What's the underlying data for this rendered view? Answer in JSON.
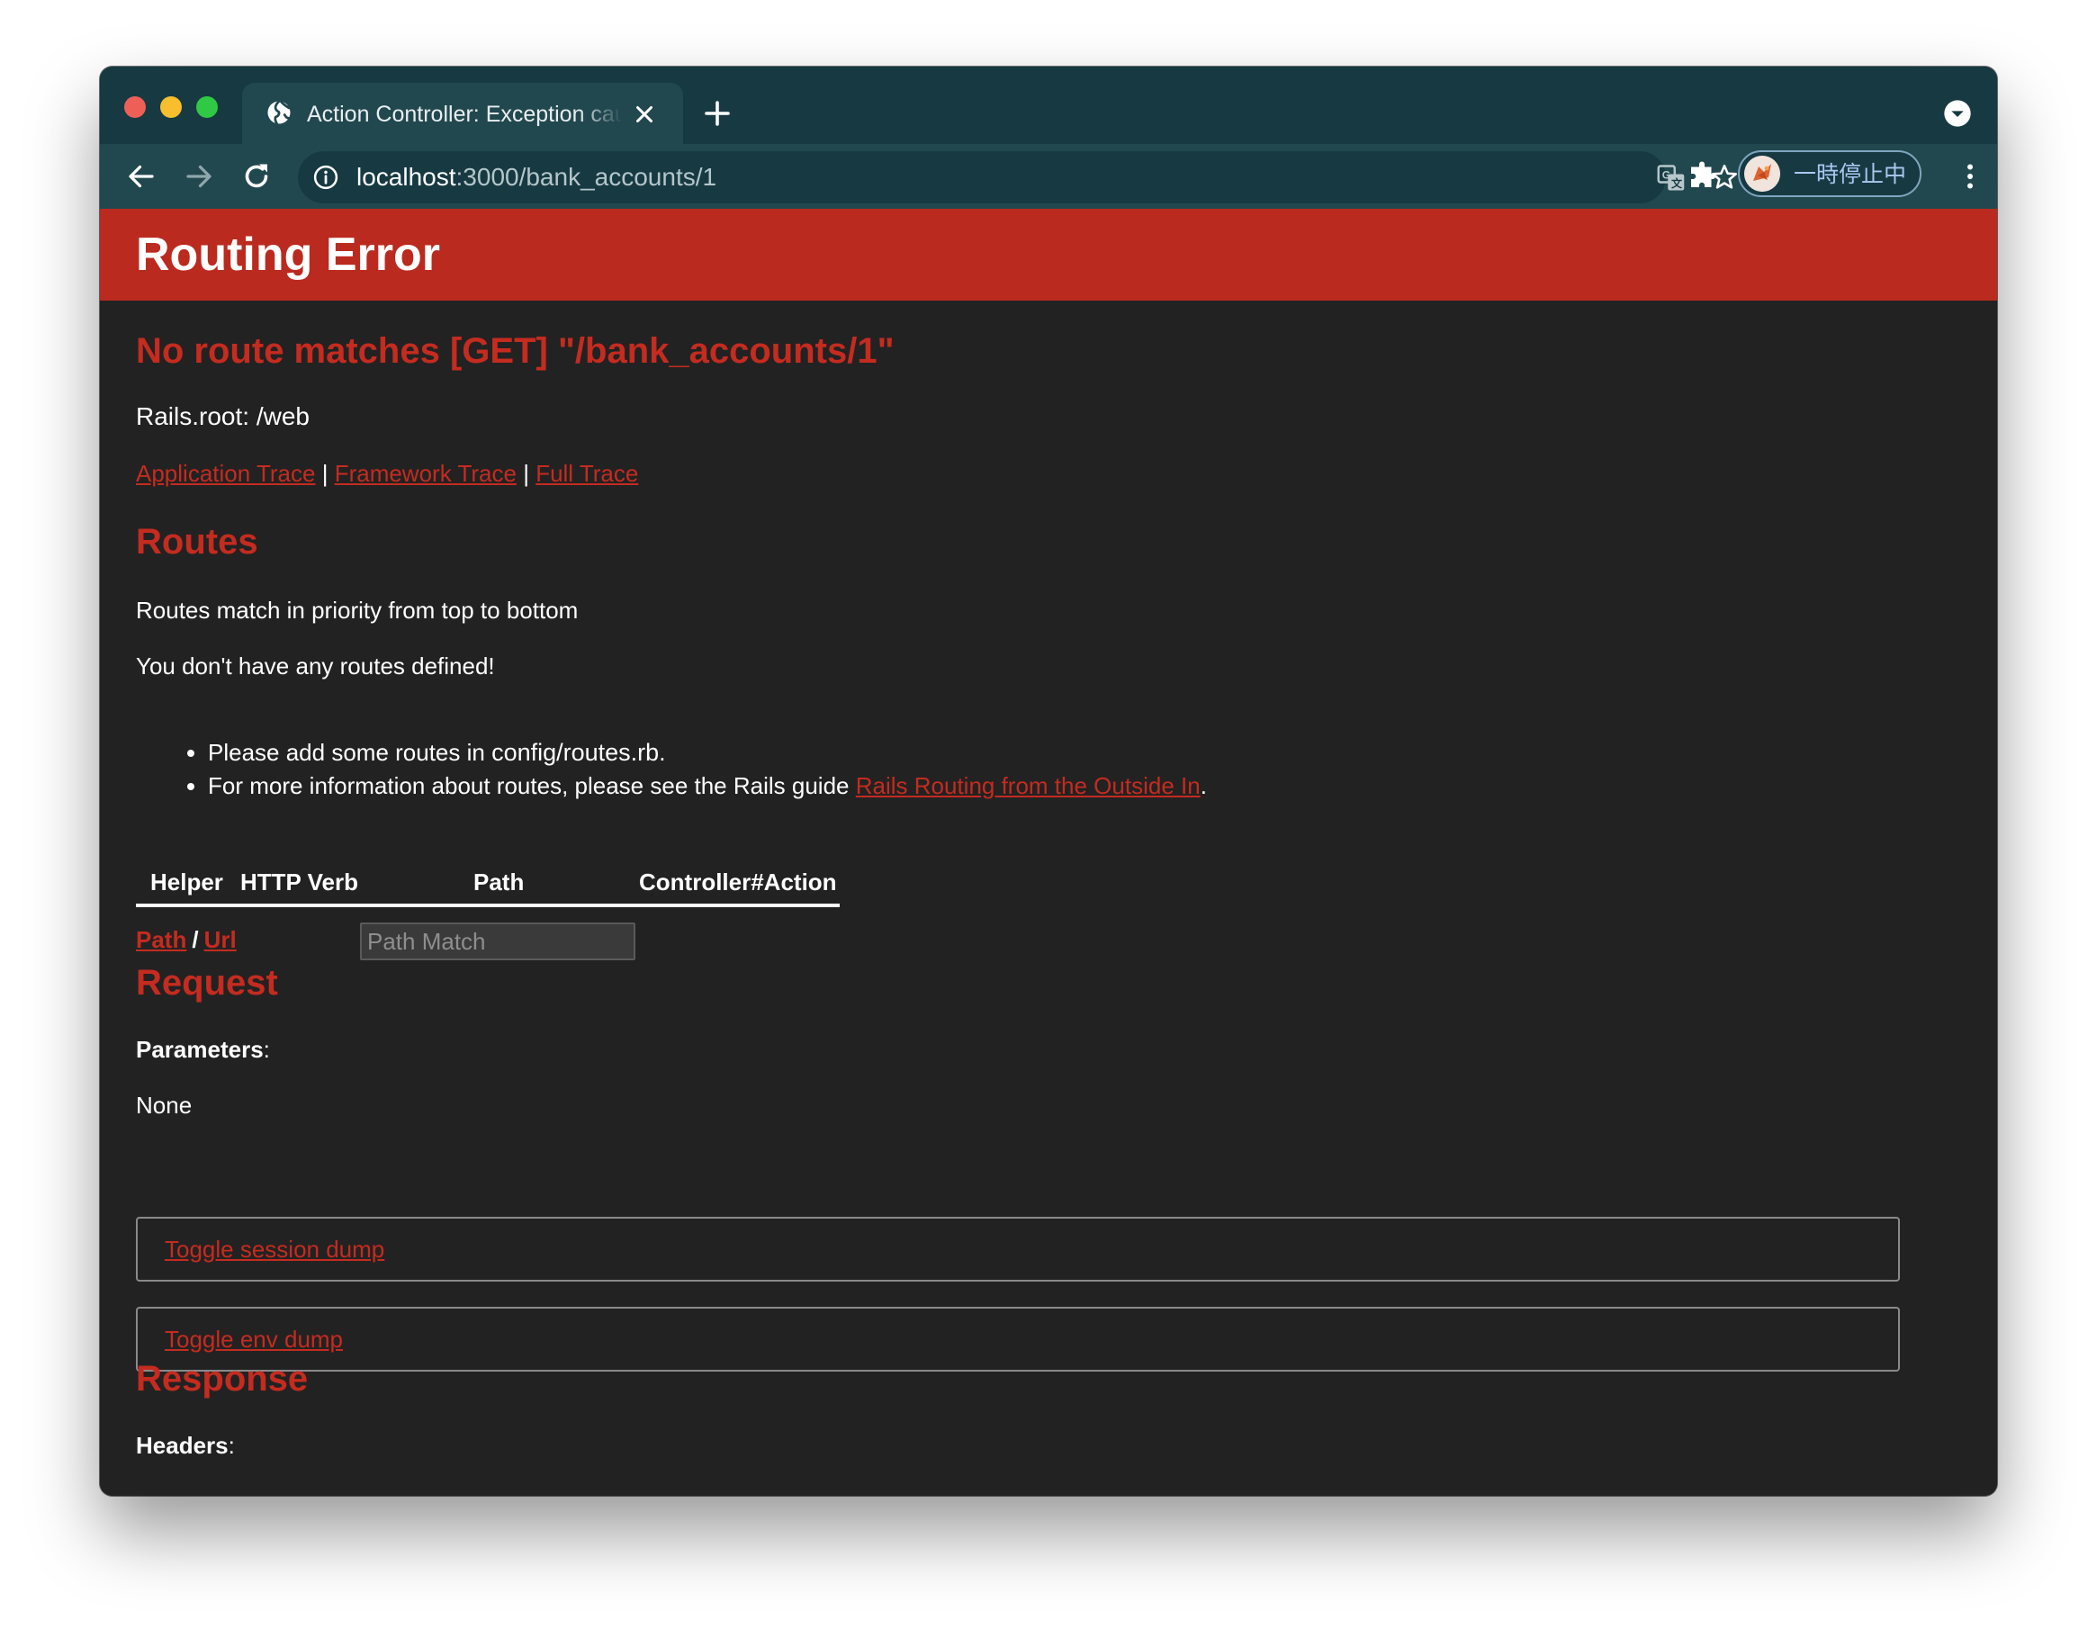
{
  "browser": {
    "tab": {
      "title": "Action Controller: Exception caught",
      "favicon": "globe-icon",
      "close_icon": "close-icon"
    },
    "new_tab_icon": "plus-icon",
    "tab_search_icon": "chevron-down-circle-icon",
    "nav": {
      "back_icon": "arrow-left-icon",
      "forward_icon": "arrow-right-icon",
      "reload_icon": "reload-icon"
    },
    "omnibox": {
      "info_icon": "info-icon",
      "url_host": "localhost",
      "url_rest": ":3000/bank_accounts/1",
      "translate_icon": "translate-icon",
      "bookmark_icon": "star-icon"
    },
    "extensions_icon": "puzzle-icon",
    "profile": {
      "label": "一時停止中",
      "avatar": "avatar"
    },
    "menu_icon": "kebab-menu-icon",
    "colors": {
      "frame": "#173942",
      "toolbar": "#22484f"
    }
  },
  "page": {
    "header_title": "Routing Error",
    "error_message": "No route matches [GET] \"/bank_accounts/1\"",
    "rails_root": "Rails.root: /web",
    "trace_links": {
      "application": "Application Trace",
      "framework": "Framework Trace",
      "full": "Full Trace",
      "separator": "|"
    },
    "routes": {
      "heading": "Routes",
      "priority_note": "Routes match in priority from top to bottom",
      "none_defined": "You don't have any routes defined!",
      "bullet_1_prefix": "Please add some routes in ",
      "bullet_1_code": "config/routes.rb",
      "bullet_1_suffix": ".",
      "bullet_2_prefix": "For more information about routes, please see the Rails guide ",
      "bullet_2_link": "Rails Routing from the Outside In",
      "bullet_2_suffix": ".",
      "table_headers": [
        "Helper",
        "HTTP Verb",
        "Path",
        "Controller#Action"
      ],
      "helper_path_link": "Path",
      "helper_sep": "/",
      "helper_url_link": "Url",
      "path_match_placeholder": "Path Match"
    },
    "request": {
      "heading": "Request",
      "parameters_label": "Parameters",
      "colon": ":",
      "parameters_value": "None",
      "toggle_session": "Toggle session dump",
      "toggle_env": "Toggle env dump"
    },
    "response": {
      "heading": "Response",
      "headers_label": "Headers",
      "colon": ":"
    },
    "colors": {
      "header_bg": "#bb2a1e",
      "accent_red": "#c52b1f",
      "page_bg": "#222222"
    }
  }
}
